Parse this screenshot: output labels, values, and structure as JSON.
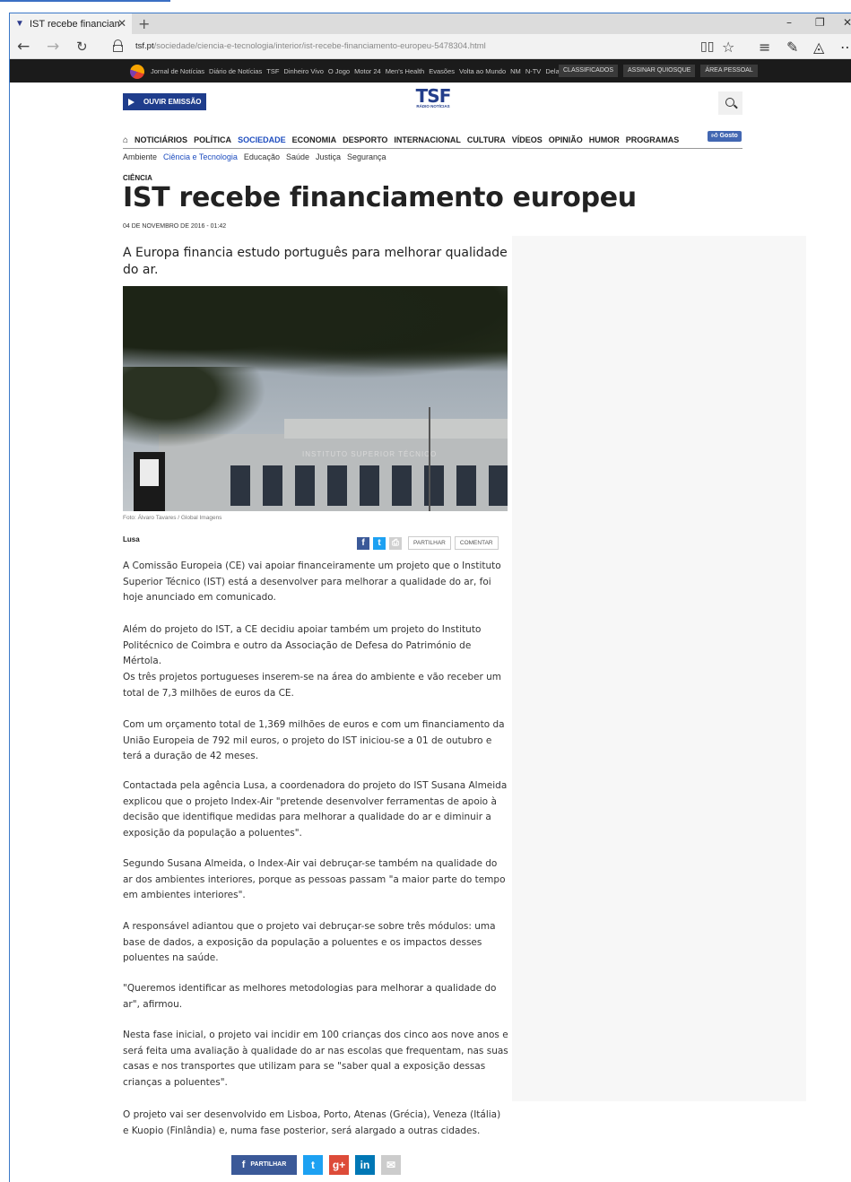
{
  "browser": {
    "tab_title": "IST recebe financiament",
    "tab_close": "✕",
    "new_tab": "+",
    "url_host": "tsf.pt",
    "url_path": "/sociedade/ciencia-e-tecnologia/interior/ist-recebe-financiamento-europeu-5478304.html",
    "win_min": "–",
    "win_max": "❐",
    "win_close": "✕"
  },
  "sitebar": {
    "links": [
      "Jornal de Notícias",
      "Diário de Notícias",
      "TSF",
      "Dinheiro Vivo",
      "O Jogo",
      "Motor 24",
      "Men's Health",
      "Evasões",
      "Volta ao Mundo",
      "NM",
      "N-TV",
      "Delas"
    ],
    "buttons": [
      "CLASSIFICADOS",
      "ASSINAR QUIOSQUE",
      "ÁREA PESSOAL"
    ]
  },
  "header": {
    "ouvir_label": "OUVIR EMISSÃO",
    "logo_text": "TSF",
    "logo_sub": "RÁDIO NOTÍCIAS"
  },
  "nav": {
    "items": [
      "NOTICIÁRIOS",
      "POLÍTICA",
      "SOCIEDADE",
      "ECONOMIA",
      "DESPORTO",
      "INTERNACIONAL",
      "CULTURA",
      "VÍDEOS",
      "OPINIÃO",
      "HUMOR",
      "PROGRAMAS"
    ],
    "gosto": "Gosto",
    "subitems": [
      "Ambiente",
      "Ciência e Tecnologia",
      "Educação",
      "Saúde",
      "Justiça",
      "Segurança"
    ]
  },
  "article": {
    "kicker": "CIÊNCIA",
    "title": "IST recebe financiamento europeu",
    "date": "04 DE NOVEMBRO DE 2016 - 01:42",
    "lead": "A Europa financia estudo português para melhorar qualidade do ar.",
    "photo_text": "INSTITUTO SUPERIOR TÉCNICO",
    "caption": "Foto: Álvaro Tavares / Global Imagens",
    "author": "Lusa",
    "share_label": "PARTILHAR",
    "comment_label": "COMENTAR",
    "paragraphs": [
      "A Comissão Europeia (CE) vai apoiar financeiramente um projeto que o Instituto Superior Técnico (IST) está a desenvolver para melhorar a qualidade do ar, foi hoje anunciado em comunicado.",
      "Além do projeto do IST, a CE decidiu apoiar também um projeto do Instituto Politécnico de Coimbra e outro da Associação de Defesa do Património de Mértola.",
      "Os três projetos portugueses inserem-se na área do ambiente e vão receber um total de 7,3 milhões de euros da CE.",
      "Com um orçamento total de 1,369 milhões de euros e com um financiamento da União Europeia de 792 mil euros, o projeto do IST iniciou-se a 01 de outubro e terá a duração de 42 meses.",
      "Contactada pela agência Lusa, a coordenadora do projeto do IST Susana Almeida explicou que o projeto Index-Air \"pretende desenvolver ferramentas de apoio à decisão que identifique medidas para melhorar a qualidade do ar e diminuir a exposição da população a poluentes\".",
      "Segundo Susana Almeida, o Index-Air vai debruçar-se também na qualidade do ar dos ambientes interiores, porque as pessoas passam \"a maior parte do tempo em ambientes interiores\".",
      "A responsável adiantou que o projeto vai debruçar-se sobre três módulos: uma base de dados, a exposição da população a poluentes e os impactos desses poluentes na saúde.",
      "\"Queremos identificar as melhores metodologias para melhorar a qualidade do ar\", afirmou.",
      "Nesta fase inicial, o projeto vai incidir em 100 crianças dos cinco aos nove anos e será feita uma avaliação à qualidade do ar nas escolas que frequentam, nas suas casas e nos transportes que utilizam para se \"saber qual a exposição dessas crianças a poluentes\".",
      "O projeto vai ser desenvolvido em Lisboa, Porto, Atenas (Grécia), Veneza (Itália) e Kuopio (Finlândia) e, numa fase posterior, será alargado a outras cidades."
    ],
    "bottom_share_label": "PARTILHAR"
  }
}
